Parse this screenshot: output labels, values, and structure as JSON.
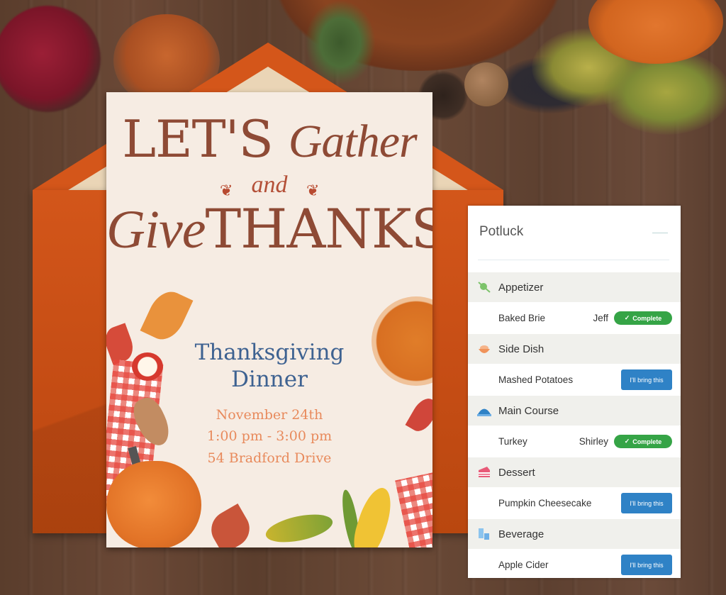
{
  "invitation": {
    "headline": {
      "lets": "LET'S",
      "gather": "Gather",
      "and": "and",
      "give": "Give",
      "thanks": "THANKS"
    },
    "event_title_line1": "Thanksgiving",
    "event_title_line2": "Dinner",
    "date": "November 24th",
    "time": "1:00 pm - 3:00 pm",
    "address": "54 Bradford Drive",
    "colors": {
      "headline": "#8e4a35",
      "title": "#3e6291",
      "details": "#e88a5c",
      "envelope": "#c44c14"
    }
  },
  "potluck": {
    "title": "Potluck",
    "categories": [
      {
        "label": "Appetizer",
        "icon": "olive-skewer-icon",
        "icon_color": "#7cc36a",
        "items": [
          {
            "name": "Baked Brie",
            "claimed_by": "Jeff",
            "status": "Complete"
          }
        ]
      },
      {
        "label": "Side Dish",
        "icon": "bowl-icon",
        "icon_color": "#f0935a",
        "items": [
          {
            "name": "Mashed Potatoes",
            "claimed_by": "",
            "action": "I'll bring this"
          }
        ]
      },
      {
        "label": "Main Course",
        "icon": "cloche-icon",
        "icon_color": "#2f82c6",
        "items": [
          {
            "name": "Turkey",
            "claimed_by": "Shirley",
            "status": "Complete"
          }
        ]
      },
      {
        "label": "Dessert",
        "icon": "cake-slice-icon",
        "icon_color": "#e85a78",
        "items": [
          {
            "name": "Pumpkin Cheesecake",
            "claimed_by": "",
            "action": "I'll bring this"
          }
        ]
      },
      {
        "label": "Beverage",
        "icon": "glasses-icon",
        "icon_color": "#6fb0e6",
        "items": [
          {
            "name": "Apple Cider",
            "claimed_by": "",
            "action": "I'll bring this"
          }
        ]
      }
    ],
    "check_glyph": "✓",
    "colors": {
      "complete": "#35a446",
      "bring": "#2f82c6",
      "category_bg": "#f0f0ec"
    }
  }
}
